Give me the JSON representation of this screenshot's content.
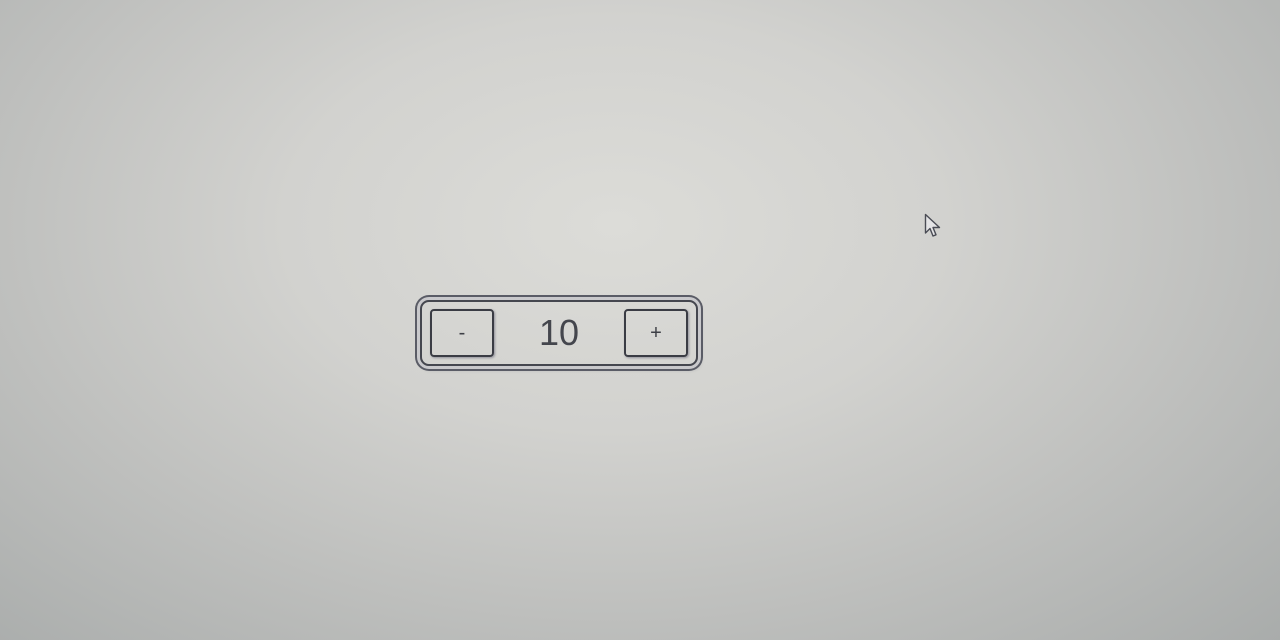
{
  "stepper": {
    "decrement_label": "-",
    "value": "10",
    "increment_label": "+"
  },
  "cursor": {
    "icon": "arrow-pointer-icon"
  }
}
